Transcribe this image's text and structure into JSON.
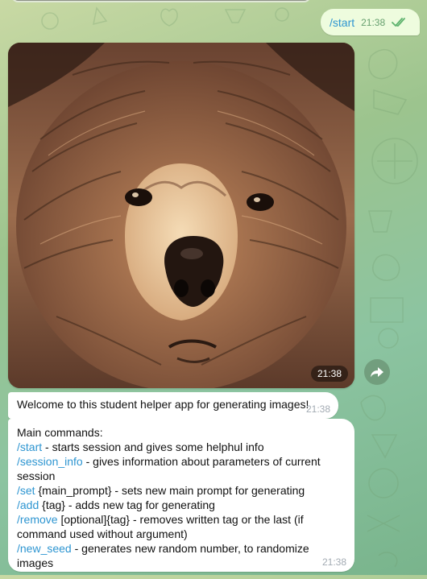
{
  "outgoing": {
    "text": "/start",
    "time": "21:38",
    "status_icon": "double-check-icon"
  },
  "photo": {
    "time": "21:38",
    "subject": "bear",
    "forward_icon": "forward-icon"
  },
  "welcome": {
    "text": "Welcome to this student helper app for generating images!",
    "time": "21:38"
  },
  "commands": {
    "title": "Main commands:",
    "items": [
      {
        "command": "/start",
        "description": " - starts session and gives some helphul info"
      },
      {
        "command": "/session_info",
        "description": " - gives information about parameters of current session"
      },
      {
        "command": "/set",
        "description": " {main_prompt} - sets new main prompt for generating"
      },
      {
        "command": "/add",
        "description": " {tag} - adds new tag for generating"
      },
      {
        "command": "/remove",
        "description": " [optional]{tag} - removes written tag or the last (if command used without argument)"
      },
      {
        "command": "/new_seed",
        "description": " - generates new random number, to randomize images"
      }
    ],
    "time": "21:38"
  },
  "colors": {
    "chat_background": "#9cc48e",
    "outgoing_bubble": "#eefcde",
    "incoming_bubble": "#ffffff",
    "link": "#2d95d1",
    "timestamp": "#a3abb3",
    "outgoing_timestamp": "#67a06f"
  }
}
